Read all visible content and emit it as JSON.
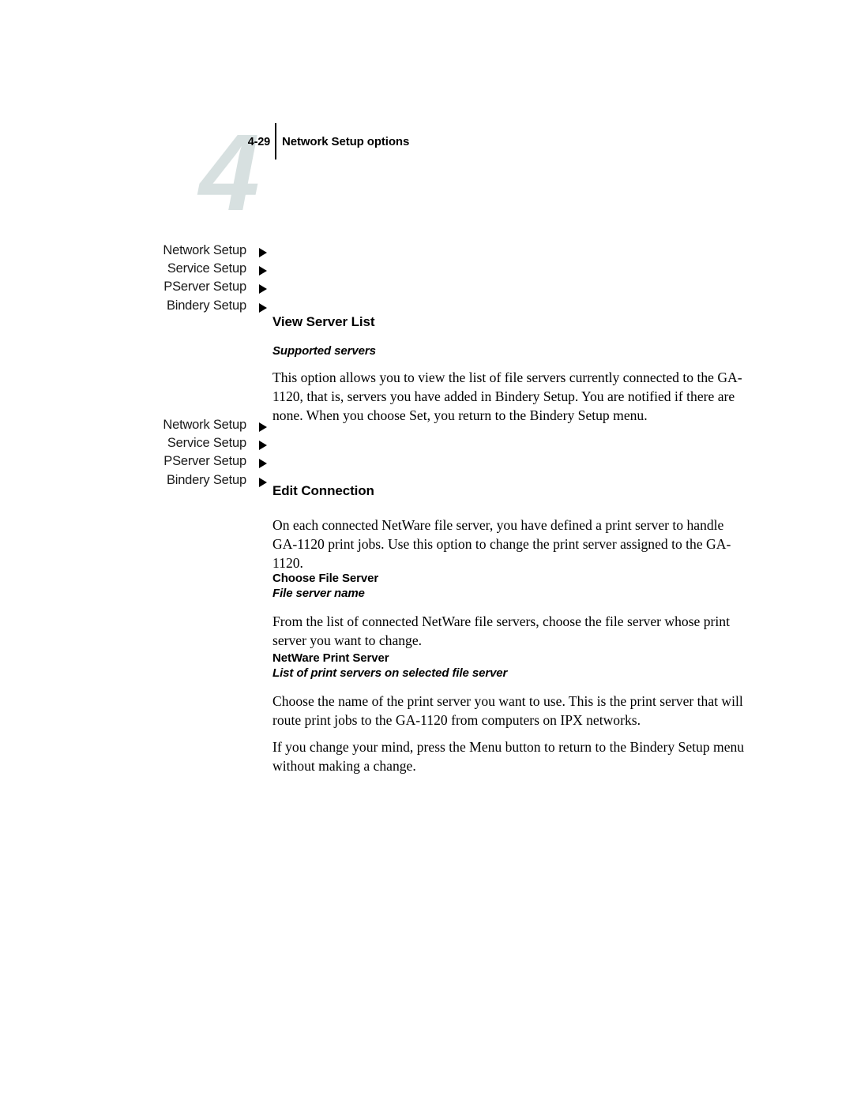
{
  "page": {
    "chapter_mark": "4",
    "folio": "4-29",
    "running_head": "Network Setup options",
    "watermark_color": "#d7e0e0"
  },
  "margin_menus": [
    {
      "id": "menu-view-server-list",
      "items": [
        {
          "label": "Network Setup",
          "marker": "triangle-right-icon"
        },
        {
          "label": "Service Setup",
          "marker": "triangle-right-icon"
        },
        {
          "label": "PServer Setup",
          "marker": "triangle-right-icon"
        },
        {
          "label": "Bindery Setup",
          "marker": "triangle-right-icon"
        }
      ]
    },
    {
      "id": "menu-edit-connection",
      "items": [
        {
          "label": "Network Setup",
          "marker": "triangle-right-icon"
        },
        {
          "label": "Service Setup",
          "marker": "triangle-right-icon"
        },
        {
          "label": "PServer Setup",
          "marker": "triangle-right-icon"
        },
        {
          "label": "Bindery Setup",
          "marker": "triangle-right-icon"
        }
      ]
    }
  ],
  "sections": {
    "view_server_list": {
      "heading": "View Server List",
      "subheading_italic": "Supported servers",
      "paragraph": "This option allows you to view the list of file servers currently connected to the GA-1120, that is, servers you have added in Bindery Setup. You are notified if there are none. When you choose Set, you return to the Bindery Setup menu."
    },
    "edit_connection": {
      "heading": "Edit Connection",
      "paragraph": "On each connected NetWare file server, you have defined a print server to handle GA-1120 print jobs. Use this option to change the print server assigned to the GA-1120.",
      "choose_file_server": {
        "heading": "Choose File Server",
        "subheading_italic": "File server name",
        "paragraph": "From the list of connected NetWare file servers, choose the file server whose print server you want to change."
      },
      "netware_print_server": {
        "heading": "NetWare Print Server",
        "subheading_italic": "List of print servers on selected file server",
        "paragraph": "Choose the name of the print server you want to use. This is the print server that will route print jobs to the GA-1120 from computers on IPX networks."
      },
      "closing_paragraph": "If you change your mind, press the Menu button to return to the Bindery Setup menu without making a change."
    }
  }
}
